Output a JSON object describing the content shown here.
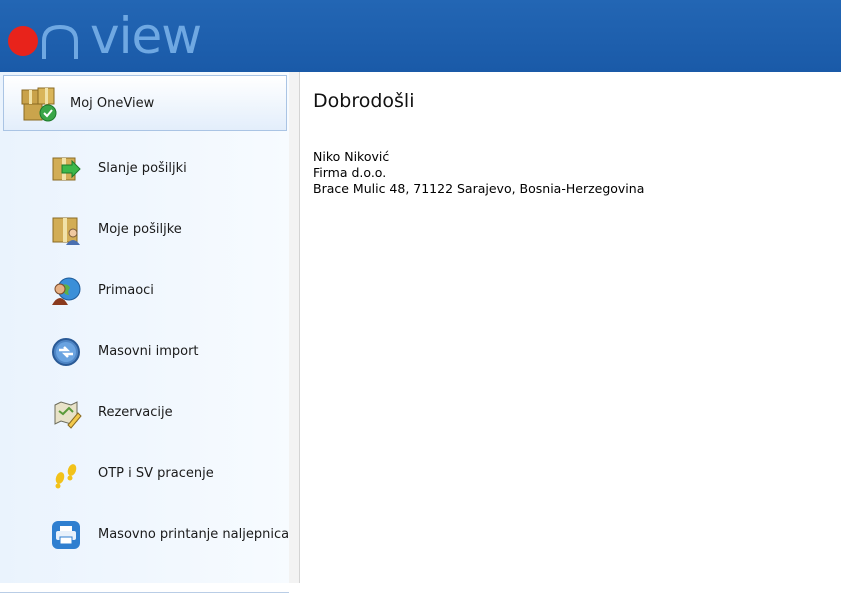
{
  "brand": {
    "logo_text": "view",
    "colors": {
      "topbar": "#1a5aa8",
      "logo_o": "#e8231b",
      "logo_text": "#6fa8e2"
    }
  },
  "sidebar": {
    "header": {
      "label": "Moj OneView",
      "icon": "packages-check-icon"
    },
    "items": [
      {
        "label": "Slanje pošiljki",
        "icon": "package-send-icon"
      },
      {
        "label": "Moje pošiljke",
        "icon": "package-person-icon"
      },
      {
        "label": "Primaoci",
        "icon": "contacts-globe-icon"
      },
      {
        "label": "Masovni import",
        "icon": "sync-import-icon"
      },
      {
        "label": "Rezervacije",
        "icon": "reservation-map-icon"
      },
      {
        "label": "OTP i SV pracenje",
        "icon": "footprints-icon"
      },
      {
        "label": "Masovno printanje naljepnica",
        "icon": "printer-icon"
      }
    ]
  },
  "main": {
    "welcome": "Dobrodošli",
    "user_name": "Niko Niković",
    "company": "Firma d.o.o.",
    "address": "Brace Mulic 48, 71122 Sarajevo, Bosnia-Herzegovina"
  }
}
